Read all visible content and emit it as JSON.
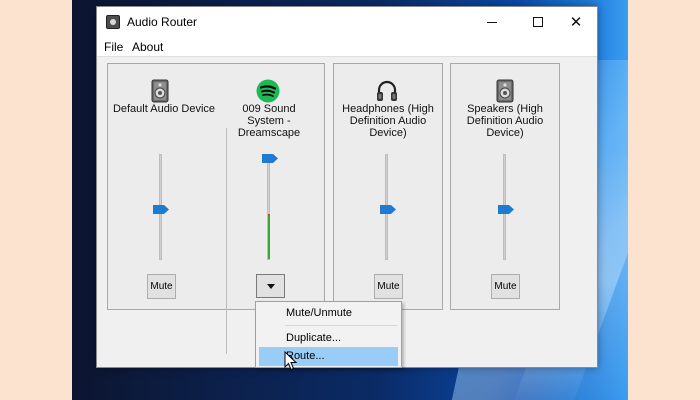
{
  "window": {
    "title": "Audio Router",
    "controls": {
      "minimize": "minimize-icon",
      "maximize": "maximize-icon",
      "close": "✕"
    }
  },
  "menubar": {
    "items": [
      "File",
      "About"
    ]
  },
  "devices": [
    {
      "label": "Default Audio Device",
      "icon": "speaker-icon",
      "volume": 0.5,
      "button": "Mute"
    },
    {
      "label": "009 Sound System - Dreamscape",
      "icon": "spotify-icon",
      "volume": 1.0,
      "level": 0.4,
      "button_icon": "dropdown-arrow-icon"
    },
    {
      "label": "Headphones (High Definition Audio Device)",
      "icon": "headphones-icon",
      "volume": 0.5,
      "button": "Mute"
    },
    {
      "label": "Speakers (High Definition Audio Device)",
      "icon": "speaker-icon",
      "volume": 0.5,
      "button": "Mute"
    }
  ],
  "context_menu": {
    "items": [
      "Mute/Unmute",
      "Duplicate...",
      "Route..."
    ],
    "highlighted": "Route..."
  },
  "colors": {
    "slider_thumb": "#1f7ad1",
    "spotify": "#1db954",
    "highlight": "#99ccf7",
    "level_meter": "#3aa63a"
  }
}
